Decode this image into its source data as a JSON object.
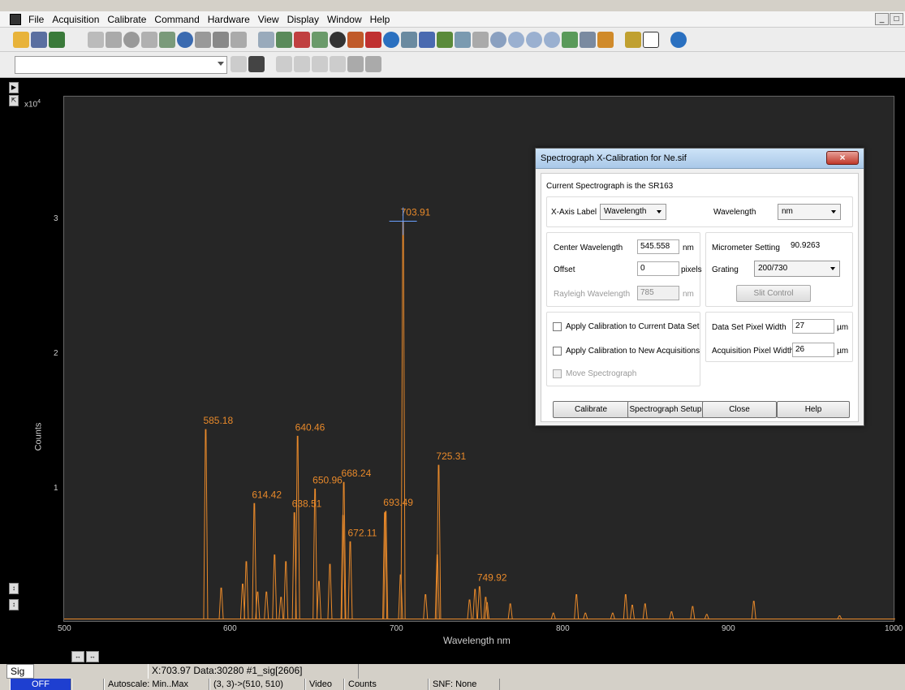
{
  "menu": [
    "File",
    "Acquisition",
    "Calibrate",
    "Command",
    "Hardware",
    "View",
    "Display",
    "Window",
    "Help"
  ],
  "window_controls": [
    "_",
    "□"
  ],
  "plot": {
    "y_multiplier": "x10",
    "y_exponent": "4",
    "y_axis_label": "Counts",
    "x_axis_label": "Wavelength nm",
    "x_ticks": [
      "500",
      "600",
      "700",
      "800",
      "900",
      "1000"
    ],
    "y_ticks": [
      "1",
      "2",
      "3"
    ],
    "cursor_label": "703.91",
    "line_color": "#e8892a"
  },
  "chart_data": {
    "type": "line",
    "xlabel": "Wavelength nm",
    "ylabel": "Counts",
    "xlim": [
      500,
      1000
    ],
    "ylim": [
      0,
      38000
    ],
    "peaks": [
      {
        "x": 585.18,
        "y": 14500,
        "label": "585.18"
      },
      {
        "x": 594.5,
        "y": 2500
      },
      {
        "x": 607.4,
        "y": 2800
      },
      {
        "x": 609.6,
        "y": 4500
      },
      {
        "x": 614.42,
        "y": 8900,
        "label": "614.42"
      },
      {
        "x": 616.4,
        "y": 2200
      },
      {
        "x": 621.7,
        "y": 2200
      },
      {
        "x": 626.6,
        "y": 5000
      },
      {
        "x": 630.5,
        "y": 1800
      },
      {
        "x": 633.4,
        "y": 4500
      },
      {
        "x": 638.51,
        "y": 8200,
        "label": "638.51"
      },
      {
        "x": 640.46,
        "y": 14000,
        "label": "640.46"
      },
      {
        "x": 650.96,
        "y": 10000,
        "label": "650.96"
      },
      {
        "x": 653.3,
        "y": 3000
      },
      {
        "x": 659.9,
        "y": 4300
      },
      {
        "x": 667.8,
        "y": 8000
      },
      {
        "x": 668.24,
        "y": 10500,
        "label": "668.24"
      },
      {
        "x": 672.11,
        "y": 6000,
        "label": "672.11"
      },
      {
        "x": 692.9,
        "y": 8200
      },
      {
        "x": 693.49,
        "y": 8300,
        "label": "693.49"
      },
      {
        "x": 702.4,
        "y": 3500
      },
      {
        "x": 703.91,
        "y": 30280,
        "label": "703.91"
      },
      {
        "x": 717.4,
        "y": 2000
      },
      {
        "x": 724.5,
        "y": 5000
      },
      {
        "x": 725.31,
        "y": 11800,
        "label": "725.31"
      },
      {
        "x": 743.9,
        "y": 1600
      },
      {
        "x": 747.2,
        "y": 2400
      },
      {
        "x": 749.92,
        "y": 2600,
        "label": "749.92"
      },
      {
        "x": 753.6,
        "y": 1800
      },
      {
        "x": 754.4,
        "y": 1400
      },
      {
        "x": 768.4,
        "y": 1300
      },
      {
        "x": 794.3,
        "y": 600
      },
      {
        "x": 808.2,
        "y": 2000
      },
      {
        "x": 813.6,
        "y": 600
      },
      {
        "x": 830.0,
        "y": 600
      },
      {
        "x": 837.8,
        "y": 2000
      },
      {
        "x": 841.8,
        "y": 1200
      },
      {
        "x": 849.5,
        "y": 1300
      },
      {
        "x": 865.4,
        "y": 700
      },
      {
        "x": 878.1,
        "y": 1100
      },
      {
        "x": 886.6,
        "y": 500
      },
      {
        "x": 914.9,
        "y": 1500
      },
      {
        "x": 966.5,
        "y": 400
      }
    ]
  },
  "dialog": {
    "title": "Spectrograph X-Calibration for Ne.sif",
    "close_glyph": "×",
    "current": "Current Spectrograph is the SR163",
    "xaxis_label_text": "X-Axis Label",
    "xaxis_value": "Wavelength",
    "unit_label": "Wavelength",
    "unit_value": "nm",
    "center_label": "Center Wavelength",
    "center_value": "545.558",
    "center_unit": "nm",
    "offset_label": "Offset",
    "offset_value": "0",
    "offset_unit": "pixels",
    "rayleigh_label": "Rayleigh Wavelength",
    "rayleigh_value": "785",
    "rayleigh_unit": "nm",
    "micrometer_label": "Micrometer Setting",
    "micrometer_value": "90.9263",
    "grating_label": "Grating",
    "grating_value": "200/730",
    "slit_button": "Slit Control",
    "apply_current": "Apply Calibration to Current Data Set",
    "apply_new": "Apply Calibration to New Acquisitions",
    "move_spec": "Move Spectrograph",
    "ds_pixel_label": "Data Set Pixel Width",
    "ds_pixel_value": "27",
    "acq_pixel_label": "Acquisition Pixel Width",
    "acq_pixel_value": "26",
    "um1": "µm",
    "um2": "µm",
    "btn_calibrate": "Calibrate",
    "btn_setup": "Spectrograph Setup",
    "btn_close": "Close",
    "btn_help": "Help"
  },
  "status": {
    "sig_tab": "Sig",
    "cursor": "X:703.97  Data:30280  #1_sig[2606]",
    "off": "OFF",
    "autoscale": "Autoscale: Min..Max",
    "region": "(3, 3)->(510, 510)",
    "mode": "Video",
    "units": "Counts",
    "snf": "SNF: None"
  }
}
